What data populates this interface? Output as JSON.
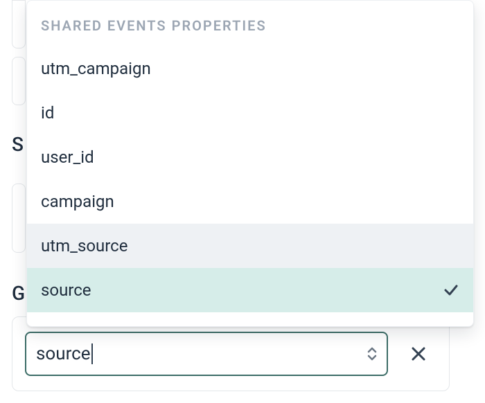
{
  "background": {
    "label_s": "S",
    "label_g": "G"
  },
  "dropdown": {
    "section_label": "Shared Events Properties",
    "options": [
      {
        "label": "utm_campaign",
        "highlight": false,
        "selected": false
      },
      {
        "label": "id",
        "highlight": false,
        "selected": false
      },
      {
        "label": "user_id",
        "highlight": false,
        "selected": false
      },
      {
        "label": "campaign",
        "highlight": false,
        "selected": false
      },
      {
        "label": "utm_source",
        "highlight": true,
        "selected": false
      },
      {
        "label": "source",
        "highlight": false,
        "selected": true
      }
    ]
  },
  "combobox": {
    "value": "source",
    "placeholder": ""
  }
}
